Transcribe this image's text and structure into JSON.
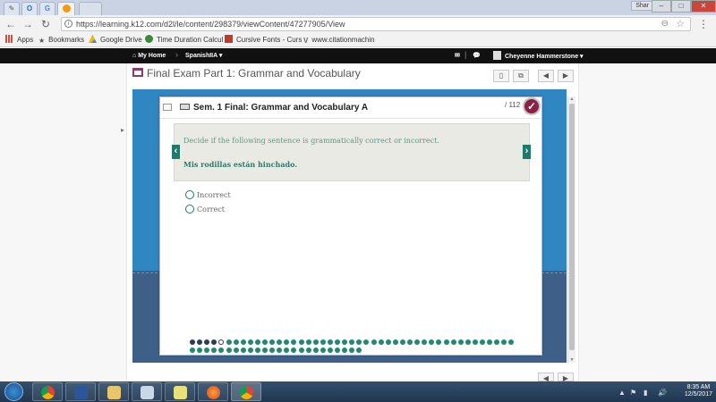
{
  "browser": {
    "tabs": [
      {
        "icon": "edit-icon"
      },
      {
        "icon": "outlook-icon"
      },
      {
        "icon": "google-icon"
      },
      {
        "icon": "k12-icon",
        "active": true
      },
      {
        "icon": "new-tab"
      }
    ],
    "profile_label": "Shar",
    "url": "https://learning.k12.com/d2l/le/content/298379/viewContent/47277905/View",
    "bookmarks": [
      {
        "label": "Apps",
        "icon": "apps-grid-icon",
        "color": "#d94a38"
      },
      {
        "label": "Bookmarks",
        "icon": "star-icon",
        "color": "#555555"
      },
      {
        "label": "Google Drive",
        "icon": "drive-icon",
        "color": "#f4b400"
      },
      {
        "label": "Time Duration Calcul",
        "icon": "clock-icon",
        "color": "#3b8a3b"
      },
      {
        "label": "Cursive Fonts - Curs",
        "icon": "font-icon",
        "color": "#c0392b"
      },
      {
        "label": "www.citationmachin",
        "icon": "citation-icon",
        "color": "#666666"
      }
    ]
  },
  "sitenav": {
    "home": "My Home",
    "course": "SpanishIIA",
    "user": "Cheyenne Hammerstone"
  },
  "page": {
    "title": "Final Exam Part 1: Grammar and Vocabulary"
  },
  "quiz": {
    "title": "Sem. 1 Final: Grammar and Vocabulary A",
    "score": "/ 112",
    "instruction": "Decide if the following sentence is grammatically correct or incorrect.",
    "sentence": "Mis rodillas están hinchado.",
    "options": [
      "Incorrect",
      "Correct"
    ],
    "progress": {
      "total_questions": 69,
      "answered": 4,
      "current": 5,
      "answered_color": "#2a3d5a",
      "unanswered_color": "#1e8a72"
    }
  },
  "taskbar": {
    "time": "8:35 AM",
    "date": "12/5/2017",
    "apps": [
      "chrome-icon",
      "word-icon",
      "explorer-icon",
      "calculator-icon",
      "notes-icon",
      "firefox-icon",
      "chrome-icon"
    ]
  }
}
